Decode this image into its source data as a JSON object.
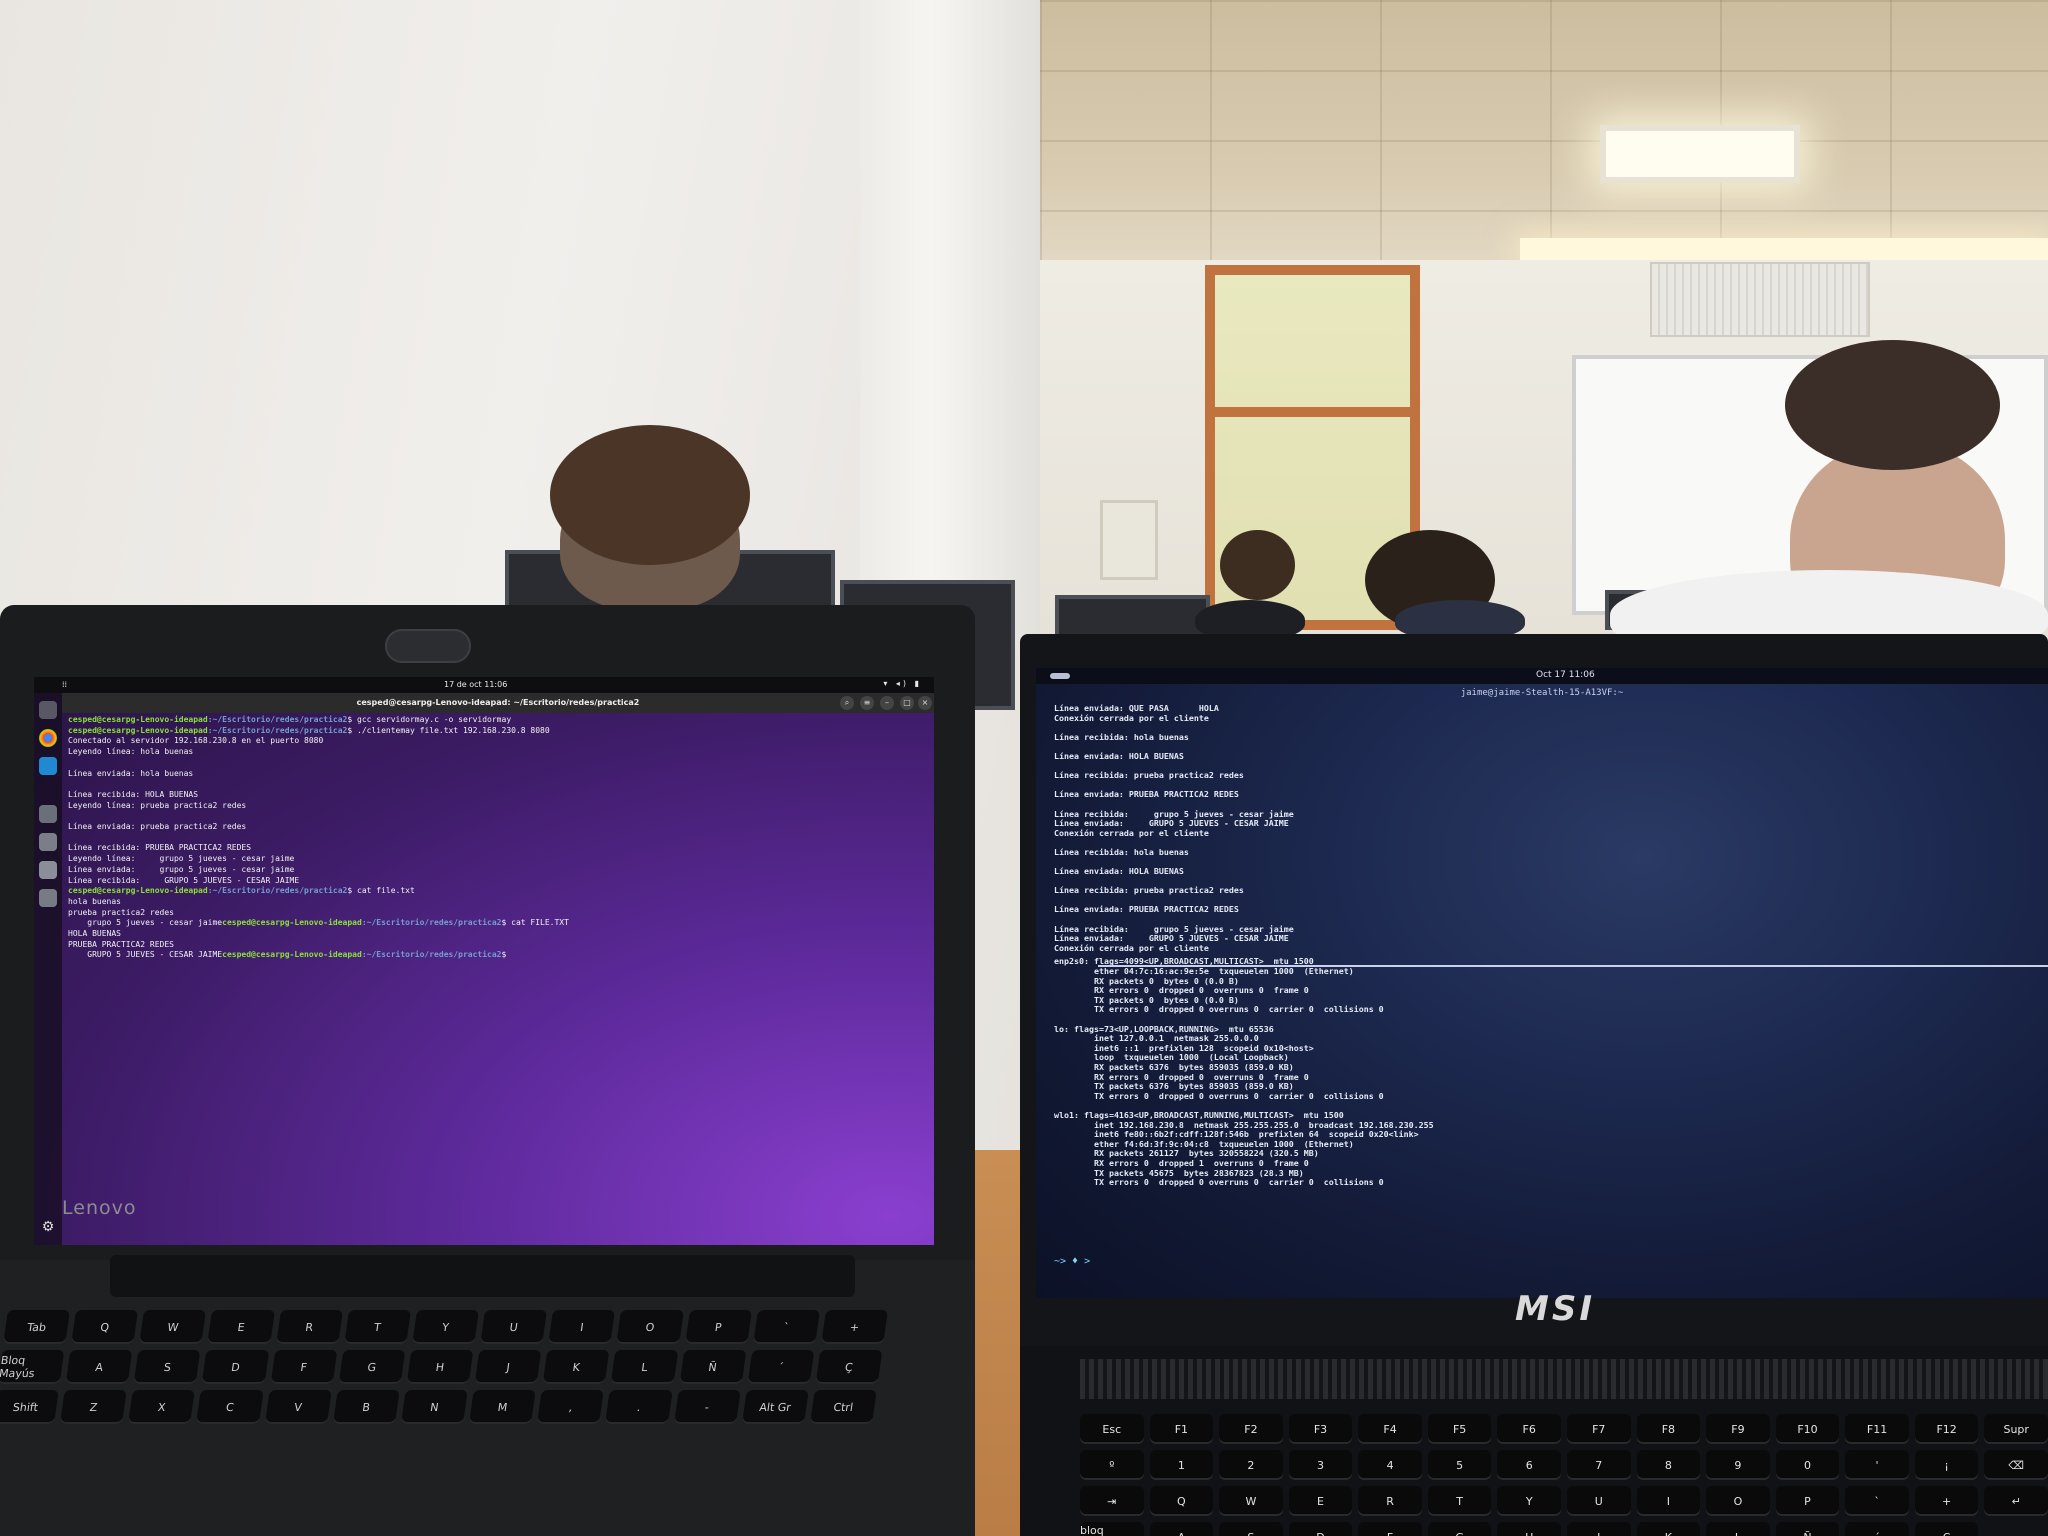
{
  "lenovo": {
    "brand": "Lenovo",
    "topbar": {
      "activities": "⁞⁞",
      "clock": "17 de oct  11:06",
      "tray": "▾ ◂) ▮"
    },
    "window_title": "cesped@cesarpg-Lenovo-ideapad: ~/Escritorio/redes/practica2",
    "terminal_lines": [
      {
        "user": "cesped@cesarpg-Lenovo-ideapad",
        "path": ":~/Escritorio/redes/practica2",
        "cmd": "$ gcc servidormay.c -o servidormay"
      },
      {
        "user": "cesped@cesarpg-Lenovo-ideapad",
        "path": ":~/Escritorio/redes/practica2",
        "cmd": "$ ./clientemay file.txt 192.168.230.8 8080"
      },
      {
        "text": "Conectado al servidor 192.168.230.8 en el puerto 8080"
      },
      {
        "text": "Leyendo línea: hola buenas"
      },
      {
        "text": ""
      },
      {
        "text": "Línea enviada: hola buenas"
      },
      {
        "text": ""
      },
      {
        "text": "Línea recibida: HOLA BUENAS"
      },
      {
        "text": "Leyendo línea: prueba practica2 redes"
      },
      {
        "text": ""
      },
      {
        "text": "Línea enviada: prueba practica2 redes"
      },
      {
        "text": ""
      },
      {
        "text": "Línea recibida: PRUEBA PRACTICA2 REDES"
      },
      {
        "text": "Leyendo línea:     grupo 5 jueves - cesar jaime"
      },
      {
        "text": "Línea enviada:     grupo 5 jueves - cesar jaime"
      },
      {
        "text": "Línea recibida:     GRUPO 5 JUEVES - CESAR JAIME"
      },
      {
        "user": "cesped@cesarpg-Lenovo-ideapad",
        "path": ":~/Escritorio/redes/practica2",
        "cmd": "$ cat file.txt"
      },
      {
        "text": "hola buenas"
      },
      {
        "text": "prueba practica2 redes"
      },
      {
        "text": "    grupo 5 jueves - cesar jaime",
        "user": "cesped@cesarpg-Lenovo-ideapad",
        "path": ":~/Escritorio/redes/practica2",
        "cmd": "$ cat FILE.TXT"
      },
      {
        "text": "HOLA BUENAS"
      },
      {
        "text": "PRUEBA PRACTICA2 REDES"
      },
      {
        "text": "    GRUPO 5 JUEVES - CESAR JAIME",
        "user": "cesped@cesarpg-Lenovo-ideapad",
        "path": ":~/Escritorio/redes/practica2",
        "cmd": "$ "
      }
    ]
  },
  "msi": {
    "brand": "MSI",
    "topbar": {
      "clock": "Oct 17  11:06"
    },
    "window_title": "jaime@jaime-Stealth-15-A13VF:~",
    "server_log": [
      "Línea enviada: QUE PASA      HOLA",
      "Conexión cerrada por el cliente",
      "",
      "Línea recibida: hola buenas",
      "",
      "Línea enviada: HOLA BUENAS",
      "",
      "Línea recibida: prueba practica2 redes",
      "",
      "Línea enviada: PRUEBA PRACTICA2 REDES",
      "",
      "Línea recibida:     grupo 5 jueves - cesar jaime",
      "Línea enviada:     GRUPO 5 JUEVES - CESAR JAIME",
      "Conexión cerrada por el cliente",
      "",
      "Línea recibida: hola buenas",
      "",
      "Línea enviada: HOLA BUENAS",
      "",
      "Línea recibida: prueba practica2 redes",
      "",
      "Línea enviada: PRUEBA PRACTICA2 REDES",
      "",
      "Línea recibida:     grupo 5 jueves - cesar jaime",
      "Línea enviada:     GRUPO 5 JUEVES - CESAR JAIME",
      "Conexión cerrada por el cliente"
    ],
    "ifconfig": [
      "enp2s0: flags=4099<UP,BROADCAST,MULTICAST>  mtu 1500",
      "        ether 04:7c:16:ac:9e:5e  txqueuelen 1000  (Ethernet)",
      "        RX packets 0  bytes 0 (0.0 B)",
      "        RX errors 0  dropped 0  overruns 0  frame 0",
      "        TX packets 0  bytes 0 (0.0 B)",
      "        TX errors 0  dropped 0 overruns 0  carrier 0  collisions 0",
      "",
      "lo: flags=73<UP,LOOPBACK,RUNNING>  mtu 65536",
      "        inet 127.0.0.1  netmask 255.0.0.0",
      "        inet6 ::1  prefixlen 128  scopeid 0x10<host>",
      "        loop  txqueuelen 1000  (Local Loopback)",
      "        RX packets 6376  bytes 859035 (859.0 KB)",
      "        RX errors 0  dropped 0  overruns 0  frame 0",
      "        TX packets 6376  bytes 859035 (859.0 KB)",
      "        TX errors 0  dropped 0 overruns 0  carrier 0  collisions 0",
      "",
      "wlo1: flags=4163<UP,BROADCAST,RUNNING,MULTICAST>  mtu 1500",
      "        inet 192.168.230.8  netmask 255.255.255.0  broadcast 192.168.230.255",
      "        inet6 fe80::6b2f:cdff:128f:546b  prefixlen 64  scopeid 0x20<link>",
      "        ether f4:6d:3f:9c:04:c8  txqueuelen 1000  (Ethernet)",
      "        RX packets 261127  bytes 320558224 (320.5 MB)",
      "        RX errors 0  dropped 1  overruns 0  frame 0",
      "        TX packets 45675  bytes 28367823 (28.3 MB)",
      "        TX errors 0  dropped 0 overruns 0  carrier 0  collisions 0"
    ],
    "prompt": "~> ♦ >"
  },
  "keyboard": {
    "lenovo_keys": [
      "Tab",
      "Q",
      "W",
      "E",
      "R",
      "T",
      "Y",
      "U",
      "I",
      "O",
      "P",
      "`",
      "+",
      "Bloq Mayús",
      "A",
      "S",
      "D",
      "F",
      "G",
      "H",
      "J",
      "K",
      "L",
      "Ñ",
      "´",
      "Ç",
      "Shift",
      "Z",
      "X",
      "C",
      "V",
      "B",
      "N",
      "M",
      ",",
      ".",
      "-",
      "Alt Gr",
      "Ctrl"
    ],
    "msi_keys": [
      "Esc",
      "F1",
      "F2",
      "F3",
      "F4",
      "F5",
      "F6",
      "F7",
      "F8",
      "F9",
      "F10",
      "F11",
      "F12",
      "Supr",
      "º",
      "1",
      "2",
      "3",
      "4",
      "5",
      "6",
      "7",
      "8",
      "9",
      "0",
      "'",
      "¡",
      "⌫",
      "⇥",
      "Q",
      "W",
      "E",
      "R",
      "T",
      "Y",
      "U",
      "I",
      "O",
      "P",
      "`",
      "+",
      "↵",
      "bloq mayús",
      "A",
      "S",
      "D",
      "F",
      "G",
      "H",
      "J",
      "K",
      "L",
      "Ñ",
      "´",
      "Ç"
    ]
  },
  "colors": {
    "ubuntu_purple": "#5e2a9c",
    "prompt_green": "#8ae234",
    "prompt_blue": "#729fcf",
    "msi_bg": "#1d2950",
    "desk": "#c88e54"
  }
}
